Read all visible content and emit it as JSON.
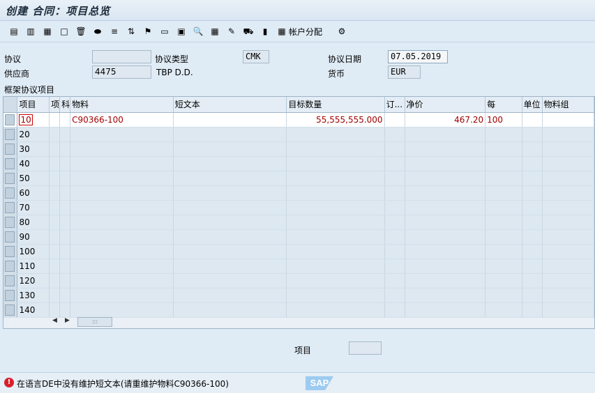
{
  "window": {
    "title": "创建 合同：项目总览"
  },
  "toolbar": {
    "account_assignment_label": "帐户分配",
    "icons": [
      "header-icon",
      "item-detail-icon",
      "item-conditions-icon",
      "new-icon",
      "delete-icon",
      "copy-icon",
      "text-icon",
      "sort-icon",
      "filter-icon",
      "print-icon",
      "select-icon",
      "find-icon",
      "services-icon",
      "edit-icon",
      "delivery-icon",
      "structure-icon",
      "account-assignment-icon",
      "config-icon"
    ],
    "glyphs": [
      "▤",
      "▥",
      "▦",
      "□",
      "🗑",
      "⬬",
      "≡",
      "⇅",
      "⚑",
      "▭",
      "▣",
      "🔍",
      "▦",
      "✎",
      "⛟",
      "▮",
      "▦",
      "⚙"
    ]
  },
  "header": {
    "agreement_label": "协议",
    "agreement_value": "",
    "agreement_type_label": "协议类型",
    "agreement_type_value": "CMK",
    "agreement_date_label": "协议日期",
    "agreement_date_value": "07.05.2019",
    "vendor_label": "供应商",
    "vendor_value": "4475",
    "vendor_name": "TBP D.D.",
    "currency_label": "货币",
    "currency_value": "EUR",
    "section_label": "框架协议项目"
  },
  "table": {
    "columns": [
      "项目",
      "项",
      "科",
      "物料",
      "短文本",
      "目标数量",
      "订...",
      "净价",
      "每",
      "单位",
      "物料组"
    ],
    "rows": [
      {
        "item": "10",
        "material": "C90366-100",
        "short_text": "",
        "target_qty": "55,555,555.000",
        "order_unit": "",
        "net_price": "467.20",
        "per": "100",
        "unit": "",
        "mat_group": ""
      },
      {
        "item": "20"
      },
      {
        "item": "30"
      },
      {
        "item": "40"
      },
      {
        "item": "50"
      },
      {
        "item": "60"
      },
      {
        "item": "70"
      },
      {
        "item": "80"
      },
      {
        "item": "90"
      },
      {
        "item": "100"
      },
      {
        "item": "110"
      },
      {
        "item": "120"
      },
      {
        "item": "130"
      },
      {
        "item": "140"
      }
    ]
  },
  "footer": {
    "item_label": "项目",
    "item_value": ""
  },
  "status": {
    "type": "error",
    "message": "在语言DE中没有维护短文本(请重维护物料C90366-100)",
    "logo": "SAP"
  },
  "colors": {
    "accent": "#dfebf5",
    "error": "#d8202a",
    "row_text": "#a00000"
  }
}
